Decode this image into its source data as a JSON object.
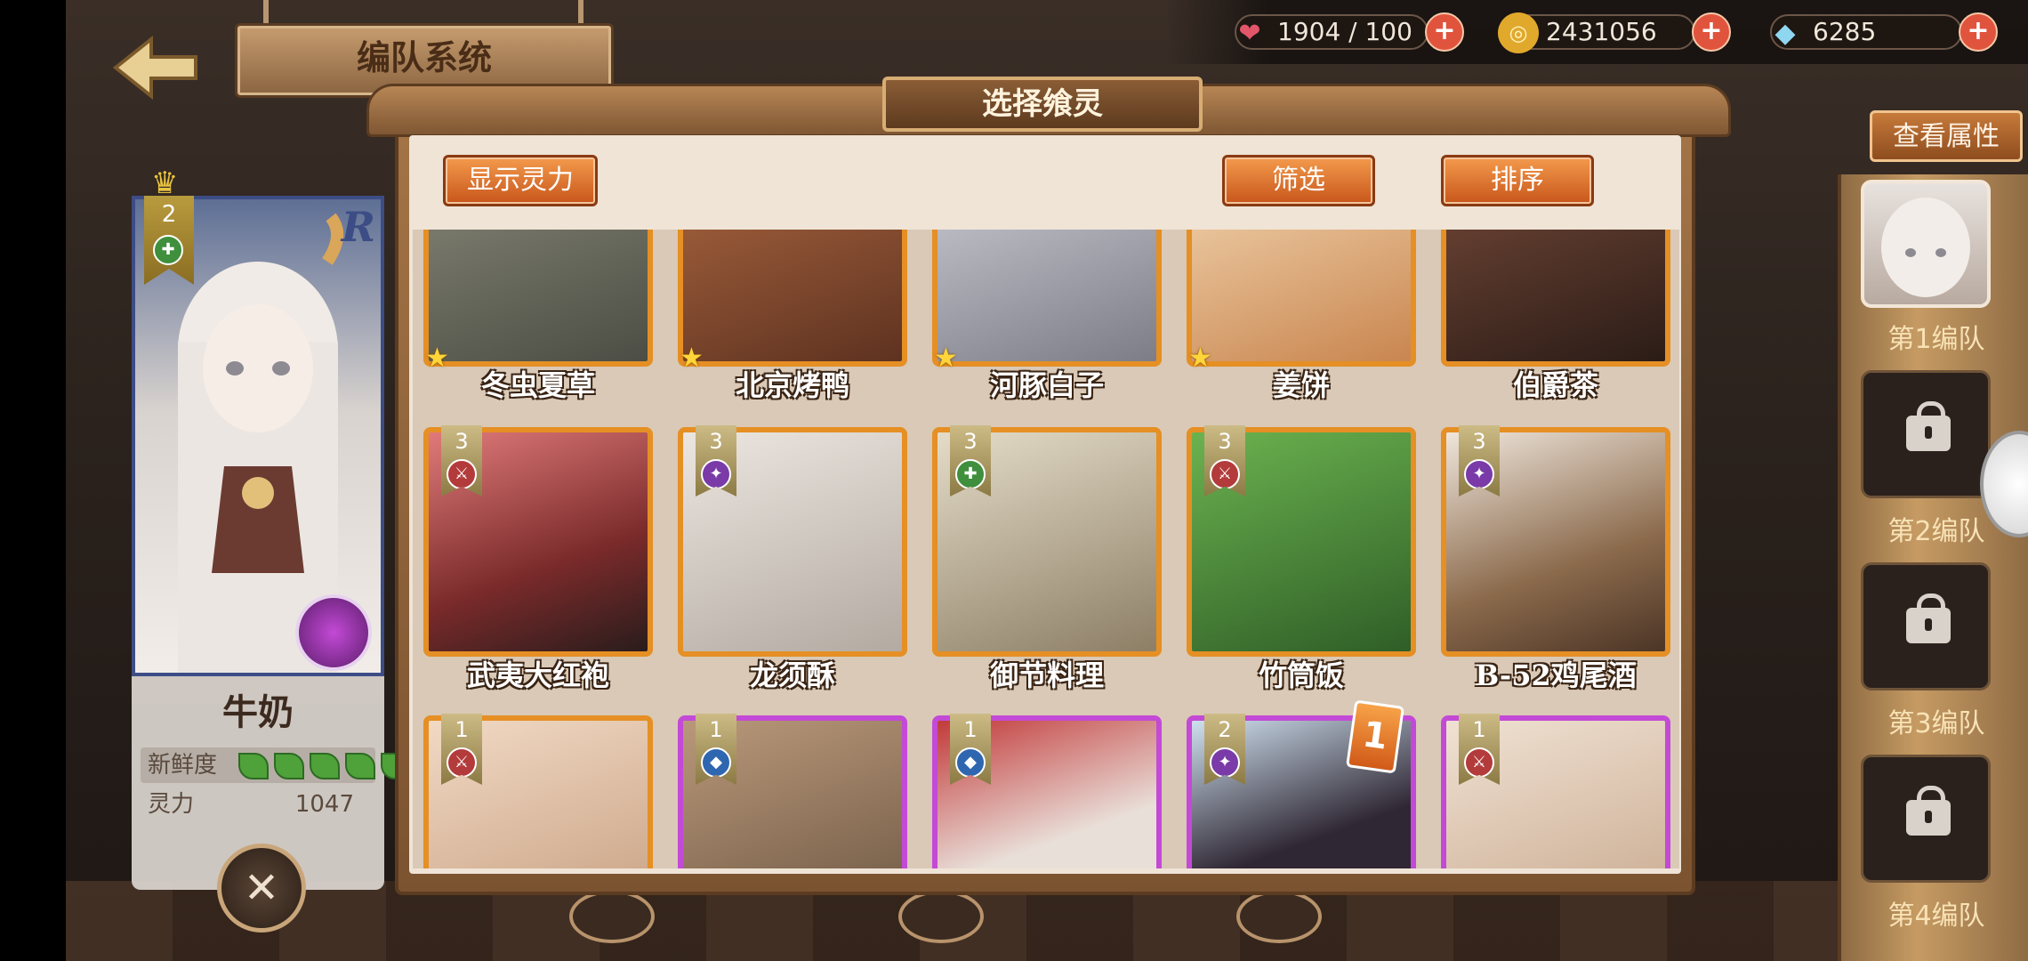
{
  "header": {
    "title": "编队系统",
    "back_label": "<"
  },
  "resources": {
    "stamina": "1904 / 100",
    "gold": "2431056",
    "crystal": "6285",
    "plus": "+"
  },
  "character": {
    "name": "牛奶",
    "rank": "2",
    "rarity": "R",
    "freshness_label": "新鲜度",
    "freshness_leaves": 5,
    "power_label": "灵力",
    "power_value": "1047"
  },
  "right_panel": {
    "view_attr": "查看属性",
    "teams": [
      "第1编队",
      "第2编队",
      "第3编队",
      "第4编队"
    ]
  },
  "modal": {
    "title": "选择飨灵",
    "show_power": "显示灵力",
    "filter": "筛选",
    "sort": "排序",
    "rows": [
      [
        {
          "name": "冬虫夏草",
          "star": "★",
          "color": "#6a6c5e"
        },
        {
          "name": "北京烤鸭",
          "star": "★",
          "color": "#8a4d2e"
        },
        {
          "name": "河豚白子",
          "star": "★",
          "color": "#a9a9b4"
        },
        {
          "name": "姜饼",
          "star": "★",
          "color": "#e6c69a"
        },
        {
          "name": "伯爵茶",
          "star": "",
          "color": "#5a3a2e"
        }
      ],
      [
        {
          "name": "武夷大红袍",
          "lv": "3",
          "cls": "⚔",
          "cls_type": "atk",
          "color": "#b54a4a"
        },
        {
          "name": "龙须酥",
          "lv": "3",
          "cls": "✦",
          "cls_type": "mag",
          "color": "#d8cfc8"
        },
        {
          "name": "御节料理",
          "lv": "3",
          "cls": "✚",
          "cls_type": "sup",
          "color": "#cfc5ae"
        },
        {
          "name": "竹筒饭",
          "lv": "3",
          "cls": "⚔",
          "cls_type": "atk",
          "color": "#4f8a3d"
        },
        {
          "name": "B-52鸡尾酒",
          "lv": "3",
          "cls": "✦",
          "cls_type": "mag",
          "color": "#7a5c44"
        }
      ],
      [
        {
          "name": "",
          "lv": "1",
          "cls": "⚔",
          "cls_type": "atk",
          "color": "#e7cdb6",
          "frame": "orange"
        },
        {
          "name": "",
          "lv": "1",
          "cls": "◆",
          "cls_type": "def",
          "color": "#a88a6c",
          "frame": "purple"
        },
        {
          "name": "",
          "lv": "1",
          "cls": "◆",
          "cls_type": "def",
          "color": "#d9c2b8",
          "frame": "purple"
        },
        {
          "name": "",
          "lv": "2",
          "cls": "✦",
          "cls_type": "mag",
          "color": "#3b3240",
          "frame": "purple",
          "badge": "1"
        },
        {
          "name": "",
          "lv": "1",
          "cls": "⚔",
          "cls_type": "atk",
          "color": "#e0c6b3",
          "frame": "purple"
        }
      ]
    ]
  }
}
